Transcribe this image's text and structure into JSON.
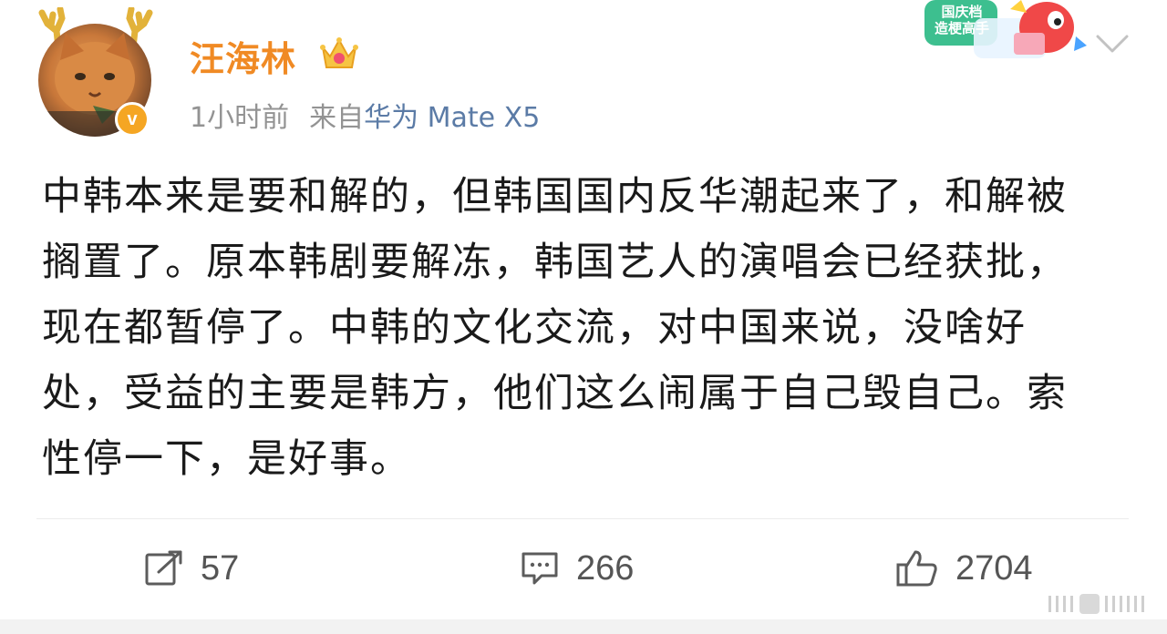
{
  "post": {
    "author": {
      "name": "汪海林",
      "verified": true,
      "verify_mark": "v",
      "avatar_icon": "orange-cat-avatar-with-antlers",
      "crown_icon": "crown-icon"
    },
    "meta": {
      "time": "1小时前",
      "source_prefix": "来自",
      "source_name": "华为 Mate X5"
    },
    "event_badge": {
      "line1": "国庆档",
      "line2": "造梗高手"
    },
    "content": "中韩本来是要和解的，但韩国国内反华潮起来了，和解被搁置了。原本韩剧要解冻，韩国艺人的演唱会已经获批，现在都暂停了。中韩的文化交流，对中国来说，没啥好处，受益的主要是韩方，他们这么闹属于自己毁自己。索性停一下，是好事。",
    "actions": {
      "repost_count": "57",
      "comment_count": "266",
      "like_count": "2704"
    }
  },
  "colors": {
    "username": "#f08a24",
    "source_link": "#5b7ba6",
    "meta_gray": "#939393",
    "text": "#1a1a1a",
    "action_gray": "#555555"
  }
}
